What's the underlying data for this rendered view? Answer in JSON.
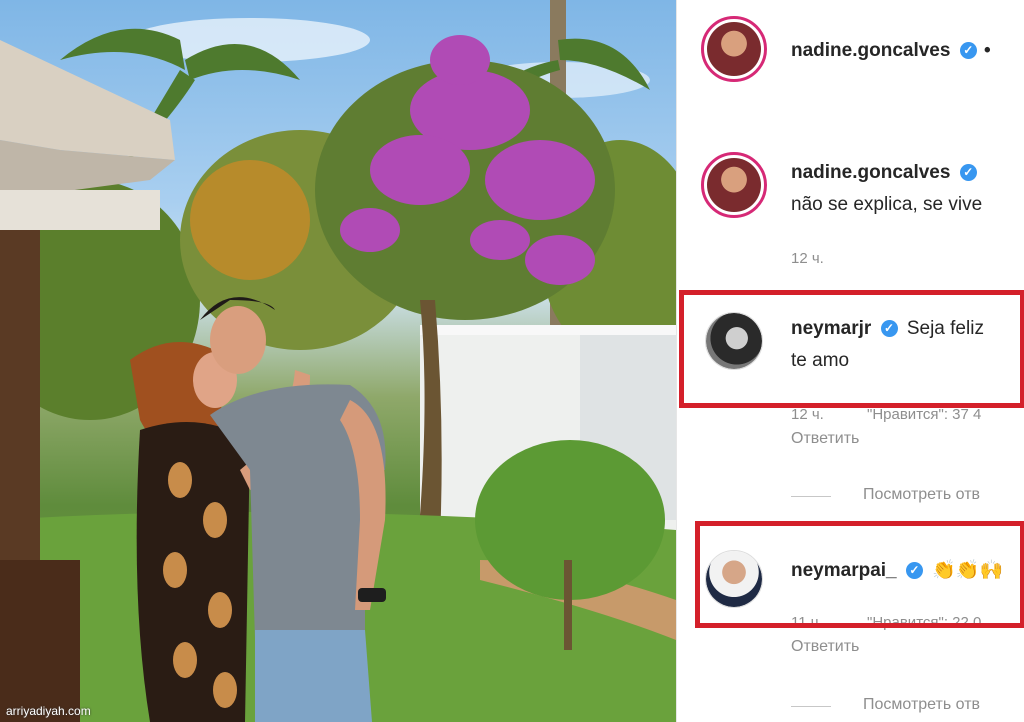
{
  "photo": {
    "watermark": "arriyadiyah.com"
  },
  "post": {
    "author": "nadine.goncalves",
    "author_dots": "•"
  },
  "comments": [
    {
      "username": "nadine.goncalves",
      "text": "não se explica, se vive",
      "time": "12 ч."
    },
    {
      "username": "neymarjr",
      "text_line1": "Seja feliz",
      "text_line2": "te amo",
      "time": "12 ч.",
      "likes": "\"Нравится\": 37 4",
      "reply": "Ответить",
      "view_replies": "Посмотреть отв"
    },
    {
      "username": "neymarpai_",
      "text": "👏👏🙌",
      "time": "11 ч.",
      "likes": "\"Нравится\": 22 0",
      "reply": "Ответить",
      "view_replies": "Посмотреть отв"
    }
  ],
  "colors": {
    "highlight": "#d4202a",
    "verified": "#3897f0",
    "username": "#262626",
    "meta": "#8e8e8e"
  },
  "icons": [
    "verified-badge-icon"
  ]
}
